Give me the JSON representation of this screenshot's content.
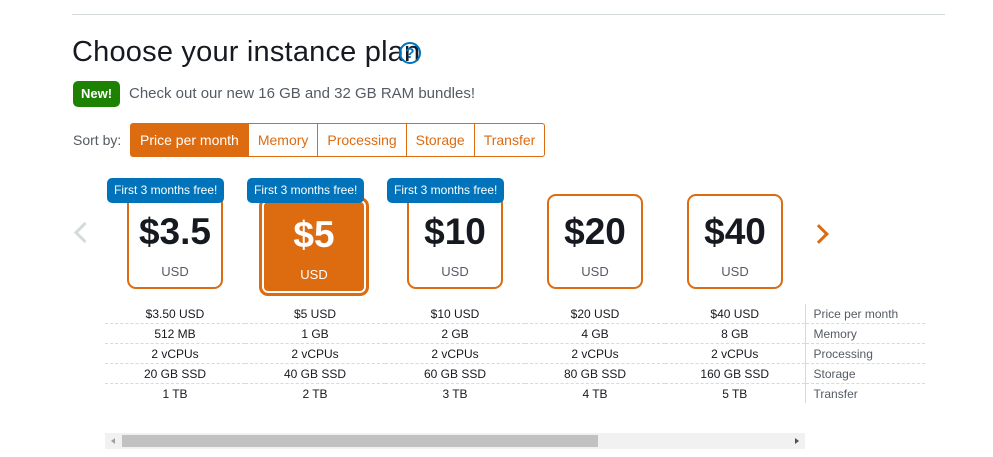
{
  "header": {
    "title": "Choose your instance plan",
    "help_icon": "?"
  },
  "announcement": {
    "badge": "New!",
    "text": "Check out our new 16 GB and 32 GB RAM bundles!"
  },
  "sort": {
    "label": "Sort by:",
    "options": [
      "Price per month",
      "Memory",
      "Processing",
      "Storage",
      "Transfer"
    ],
    "active": "Price per month"
  },
  "promo_label": "First 3 months free!",
  "plans": [
    {
      "price": "$3.5",
      "currency": "USD",
      "promo": true,
      "selected": false,
      "specs": [
        "$3.50 USD",
        "512 MB",
        "2 vCPUs",
        "20 GB SSD",
        "1 TB"
      ]
    },
    {
      "price": "$5",
      "currency": "USD",
      "promo": true,
      "selected": true,
      "specs": [
        "$5 USD",
        "1 GB",
        "2 vCPUs",
        "40 GB SSD",
        "2 TB"
      ]
    },
    {
      "price": "$10",
      "currency": "USD",
      "promo": true,
      "selected": false,
      "specs": [
        "$10 USD",
        "2 GB",
        "2 vCPUs",
        "60 GB SSD",
        "3 TB"
      ]
    },
    {
      "price": "$20",
      "currency": "USD",
      "promo": false,
      "selected": false,
      "specs": [
        "$20 USD",
        "4 GB",
        "2 vCPUs",
        "80 GB SSD",
        "4 TB"
      ]
    },
    {
      "price": "$40",
      "currency": "USD",
      "promo": false,
      "selected": false,
      "specs": [
        "$40 USD",
        "8 GB",
        "2 vCPUs",
        "160 GB SSD",
        "5 TB"
      ]
    }
  ],
  "spec_labels": [
    "Price per month",
    "Memory",
    "Processing",
    "Storage",
    "Transfer"
  ],
  "colors": {
    "accent": "#dd6b10",
    "promo": "#0073bb",
    "new_badge": "#1d8102"
  },
  "icons": {
    "prev": "chevron-left-icon",
    "next": "chevron-right-icon",
    "help": "help-icon"
  }
}
